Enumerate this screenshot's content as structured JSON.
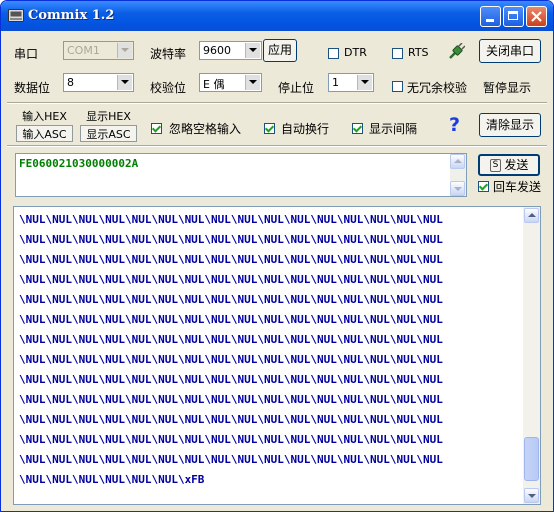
{
  "window": {
    "title": "Commix 1.2"
  },
  "row1": {
    "port_label": "串口",
    "port_value": "COM1",
    "baud_label": "波特率",
    "baud_value": "9600",
    "apply_button": "应用",
    "dtr_label": "DTR",
    "rts_label": "RTS",
    "close_port_button": "关闭串口"
  },
  "row2": {
    "databits_label": "数据位",
    "databits_value": "8",
    "parity_label": "校验位",
    "parity_value": "E 偶",
    "stopbits_label": "停止位",
    "stopbits_value": "1",
    "no_redundant_label": "无冗余校验",
    "pause_display": "暂停显示"
  },
  "row3": {
    "input_hex": "输入HEX",
    "display_hex": "显示HEX",
    "input_asc": "输入ASC",
    "display_asc": "显示ASC",
    "ignore_space_label": "忽略空格输入",
    "auto_newline_label": "自动换行",
    "show_interval_label": "显示间隔",
    "help_glyph": "?",
    "clear_display_button": "清除显示"
  },
  "send": {
    "text": "FE060021030000002A",
    "send_key": "S",
    "send_label": "发送",
    "enter_send_label": "回车发送"
  },
  "receive": {
    "lines": [
      "\\NUL\\NUL\\NUL\\NUL\\NUL\\NUL\\NUL\\NUL\\NUL\\NUL\\NUL\\NUL\\NUL\\NUL\\NUL\\NUL",
      "\\NUL\\NUL\\NUL\\NUL\\NUL\\NUL\\NUL\\NUL\\NUL\\NUL\\NUL\\NUL\\NUL\\NUL\\NUL\\NUL",
      "\\NUL\\NUL\\NUL\\NUL\\NUL\\NUL\\NUL\\NUL\\NUL\\NUL\\NUL\\NUL\\NUL\\NUL\\NUL\\NUL",
      "\\NUL\\NUL\\NUL\\NUL\\NUL\\NUL\\NUL\\NUL\\NUL\\NUL\\NUL\\NUL\\NUL\\NUL\\NUL\\NUL",
      "\\NUL\\NUL\\NUL\\NUL\\NUL\\NUL\\NUL\\NUL\\NUL\\NUL\\NUL\\NUL\\NUL\\NUL\\NUL\\NUL",
      "\\NUL\\NUL\\NUL\\NUL\\NUL\\NUL\\NUL\\NUL\\NUL\\NUL\\NUL\\NUL\\NUL\\NUL\\NUL\\NUL",
      "\\NUL\\NUL\\NUL\\NUL\\NUL\\NUL\\NUL\\NUL\\NUL\\NUL\\NUL\\NUL\\NUL\\NUL\\NUL\\NUL",
      "\\NUL\\NUL\\NUL\\NUL\\NUL\\NUL\\NUL\\NUL\\NUL\\NUL\\NUL\\NUL\\NUL\\NUL\\NUL\\NUL",
      "\\NUL\\NUL\\NUL\\NUL\\NUL\\NUL\\NUL\\NUL\\NUL\\NUL\\NUL\\NUL\\NUL\\NUL\\NUL\\NUL",
      "\\NUL\\NUL\\NUL\\NUL\\NUL\\NUL\\NUL\\NUL\\NUL\\NUL\\NUL\\NUL\\NUL\\NUL\\NUL\\NUL",
      "\\NUL\\NUL\\NUL\\NUL\\NUL\\NUL\\NUL\\NUL\\NUL\\NUL\\NUL\\NUL\\NUL\\NUL\\NUL\\NUL",
      "\\NUL\\NUL\\NUL\\NUL\\NUL\\NUL\\NUL\\NUL\\NUL\\NUL\\NUL\\NUL\\NUL\\NUL\\NUL\\NUL",
      "\\NUL\\NUL\\NUL\\NUL\\NUL\\NUL\\NUL\\NUL\\NUL\\NUL\\NUL\\NUL\\NUL\\NUL\\NUL\\NUL",
      "\\NUL\\NUL\\NUL\\NUL\\NUL\\NUL\\xFB"
    ]
  },
  "colors": {
    "titlebar": "#0a5fe6",
    "window_bg": "#ece9d8",
    "send_text": "#008000",
    "receive_text": "#0000a0",
    "help_icon": "#1a3ce0"
  },
  "icons": {
    "app": "serial-port-icon",
    "signal": "plug-icon",
    "minimize": "minimize-icon",
    "maximize": "maximize-icon",
    "close": "close-icon"
  }
}
